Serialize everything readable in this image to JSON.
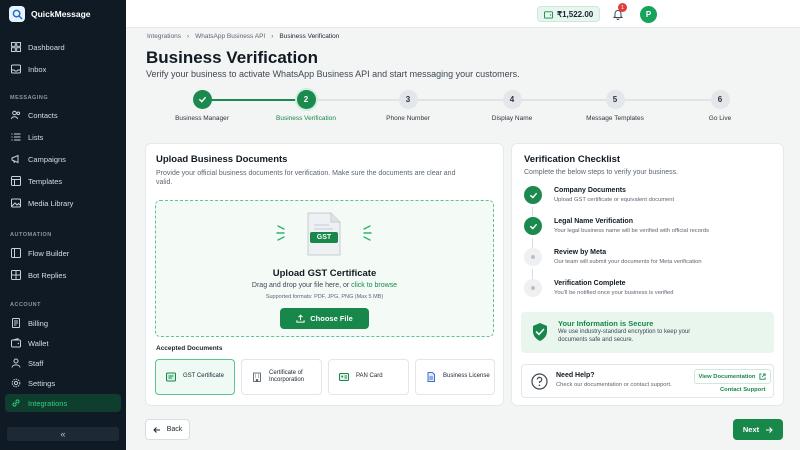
{
  "app": {
    "name": "QuickMessage"
  },
  "sidebar": {
    "items_top": [
      {
        "label": "Dashboard",
        "icon": "dashboard-icon"
      },
      {
        "label": "Inbox",
        "icon": "inbox-icon"
      }
    ],
    "sections": [
      {
        "title": "MESSAGING",
        "items": [
          {
            "label": "Contacts",
            "icon": "contacts-icon"
          },
          {
            "label": "Lists",
            "icon": "lists-icon"
          },
          {
            "label": "Campaigns",
            "icon": "campaigns-icon"
          },
          {
            "label": "Templates",
            "icon": "templates-icon"
          },
          {
            "label": "Media Library",
            "icon": "media-icon"
          }
        ]
      },
      {
        "title": "AUTOMATION",
        "items": [
          {
            "label": "Flow Builder",
            "icon": "flow-icon"
          },
          {
            "label": "Bot Replies",
            "icon": "bot-icon"
          }
        ]
      },
      {
        "title": "ACCOUNT",
        "items": [
          {
            "label": "Billing",
            "icon": "billing-icon"
          },
          {
            "label": "Wallet",
            "icon": "wallet-icon"
          },
          {
            "label": "Staff",
            "icon": "staff-icon"
          },
          {
            "label": "Settings",
            "icon": "settings-icon"
          },
          {
            "label": "Integrations",
            "icon": "integrations-icon",
            "active": true
          }
        ]
      }
    ],
    "collapse_label": "«"
  },
  "topbar": {
    "wallet_balance": "₹1,522.00",
    "notification_count": "1",
    "avatar_initial": "P"
  },
  "breadcrumb": [
    "Integrations",
    "WhatsApp Business API",
    "Business Verification"
  ],
  "page": {
    "title": "Business Verification",
    "subtitle": "Verify your business to activate WhatsApp Business API and start messaging your customers."
  },
  "steps": [
    {
      "number": "1",
      "label": "Business Manager",
      "state": "done"
    },
    {
      "number": "2",
      "label": "Business Verification",
      "state": "current"
    },
    {
      "number": "3",
      "label": "Phone Number",
      "state": "todo"
    },
    {
      "number": "4",
      "label": "Display Name",
      "state": "todo"
    },
    {
      "number": "5",
      "label": "Message Templates",
      "state": "todo"
    },
    {
      "number": "6",
      "label": "Go Live",
      "state": "todo"
    }
  ],
  "upload": {
    "title": "Upload Business Documents",
    "description": "Provide your official business documents for verification. Make sure the documents are clear and valid.",
    "file_badge": "GST",
    "drop_title": "Upload GST Certificate",
    "drop_text": "Drag and drop your file here, or",
    "drop_link": "click to browse",
    "formats": "Supported formats: PDF, JPG, PNG (Max 5 MB)",
    "choose_label": "Choose File",
    "accepted_label": "Accepted Documents",
    "documents": [
      {
        "label": "GST Certificate",
        "selected": true
      },
      {
        "label": "Certificate of Incorporation",
        "selected": false
      },
      {
        "label": "PAN Card",
        "selected": false
      },
      {
        "label": "Business License",
        "selected": false
      }
    ]
  },
  "checklist": {
    "title": "Verification Checklist",
    "subtitle": "Complete the below steps to verify your business.",
    "items": [
      {
        "title": "Company Documents",
        "desc": "Upload GST certificate or equivalent document",
        "state": "done"
      },
      {
        "title": "Legal Name Verification",
        "desc": "Your legal business name will be verified with official records",
        "state": "done"
      },
      {
        "title": "Review by Meta",
        "desc": "Our team will submit your documents for Meta verification",
        "state": "todo"
      },
      {
        "title": "Verification Complete",
        "desc": "You'll be notified once your business is verified",
        "state": "todo"
      }
    ],
    "secure": {
      "title": "Your Information is Secure",
      "desc": "We use industry-standard encryption to keep your documents safe and secure."
    },
    "help": {
      "title": "Need Help?",
      "desc": "Check our documentation or contact support.",
      "view_docs": "View Documentation",
      "contact": "Contact Support"
    }
  },
  "footer": {
    "back_label": "Back",
    "next_label": "Next"
  },
  "colors": {
    "brand_green": "#17874a",
    "sidebar_bg": "#0f1a24",
    "active_nav": "#0f3d2e"
  }
}
